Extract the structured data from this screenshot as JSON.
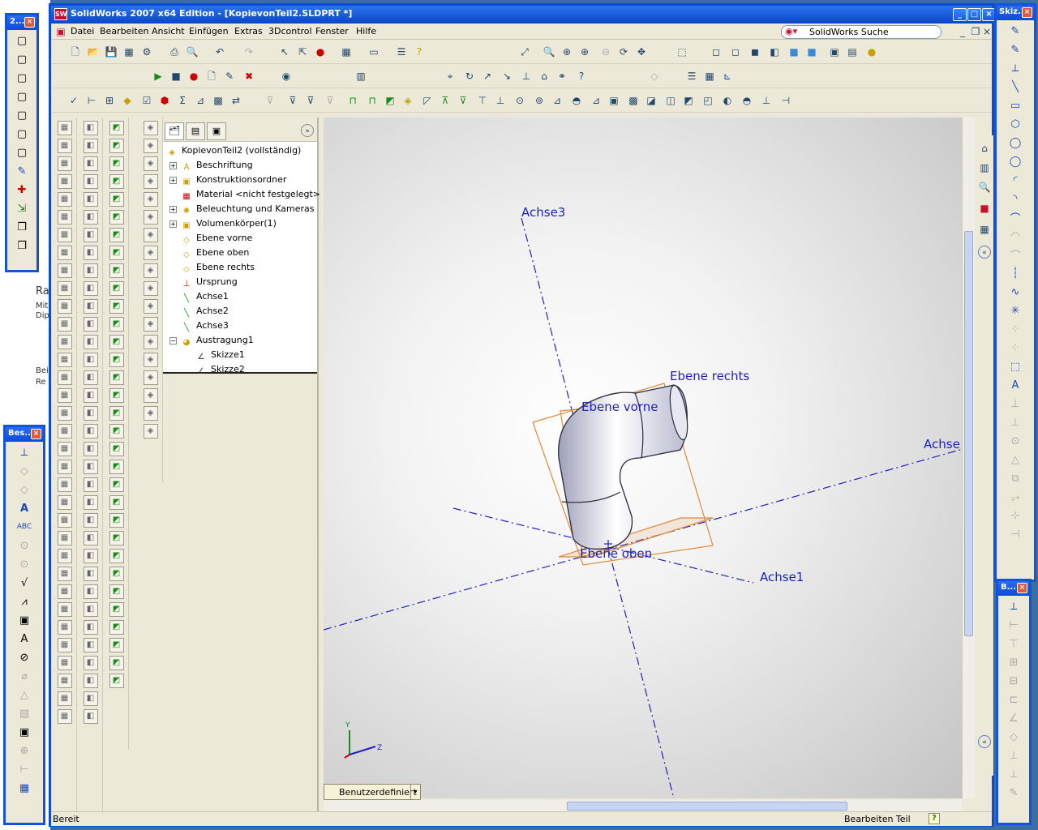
{
  "window": {
    "title": "SolidWorks 2007 x64 Edition - [KopievonTeil2.SLDPRT *]",
    "logo": "SW"
  },
  "menu": [
    "Datei",
    "Bearbeiten",
    "Ansicht",
    "Einfügen",
    "Extras",
    "3Dcontrol",
    "Fenster",
    "Hilfe"
  ],
  "search": {
    "label": "SolidWorks Suche"
  },
  "floating_toolbars": {
    "top_left": {
      "title": "2..."
    },
    "bottom_left": {
      "title": "Bes..."
    },
    "top_right": {
      "title": "Skiz..."
    },
    "bottom_right": {
      "title": "B..."
    }
  },
  "background_app": {
    "texts": [
      "Ra",
      "Mit",
      "Dip",
      "Bei",
      "Re"
    ]
  },
  "feature_tree": {
    "root": "KopievonTeil2  (vollständig)",
    "items": [
      {
        "label": "Beschriftung",
        "icon": "annotation-icon",
        "expandable": true
      },
      {
        "label": "Konstruktionsordner",
        "icon": "folder-icon",
        "expandable": true
      },
      {
        "label": "Material <nicht festgelegt>",
        "icon": "material-icon",
        "expandable": false
      },
      {
        "label": "Beleuchtung und Kameras",
        "icon": "lights-icon",
        "expandable": true
      },
      {
        "label": "Volumenkörper(1)",
        "icon": "solid-bodies-icon",
        "expandable": true
      },
      {
        "label": "Ebene vorne",
        "icon": "plane-icon",
        "expandable": false
      },
      {
        "label": "Ebene oben",
        "icon": "plane-icon",
        "expandable": false
      },
      {
        "label": "Ebene rechts",
        "icon": "plane-icon",
        "expandable": false
      },
      {
        "label": "Ursprung",
        "icon": "origin-icon",
        "expandable": false
      },
      {
        "label": "Achse1",
        "icon": "axis-icon",
        "expandable": false
      },
      {
        "label": "Achse2",
        "icon": "axis-icon",
        "expandable": false
      },
      {
        "label": "Achse3",
        "icon": "axis-icon",
        "expandable": false
      },
      {
        "label": "Austragung1",
        "icon": "sweep-icon",
        "expandable": true,
        "expanded": true
      },
      {
        "label": "Skizze1",
        "icon": "sketch-icon",
        "expandable": false,
        "child": true
      },
      {
        "label": "Skizze2",
        "icon": "sketch-icon",
        "expandable": false,
        "child": true
      }
    ]
  },
  "viewport": {
    "labels": {
      "achse3": "Achse3",
      "achse_right": "Achse",
      "achse1": "Achse1",
      "ebene_rechts": "Ebene rechts",
      "ebene_vorne": "Ebene vorne",
      "ebene_oben": "Ebene oben"
    },
    "triad": {
      "x": "Z",
      "y": "Y"
    },
    "view_tab": "Benutzerdefiniert"
  },
  "status": {
    "left": "Bereit",
    "right": "Bearbeiten Teil",
    "help": "?"
  },
  "colors": {
    "title_blue": "#0a47c8",
    "axis": "#2020c0",
    "plane": "#e08a3a"
  }
}
